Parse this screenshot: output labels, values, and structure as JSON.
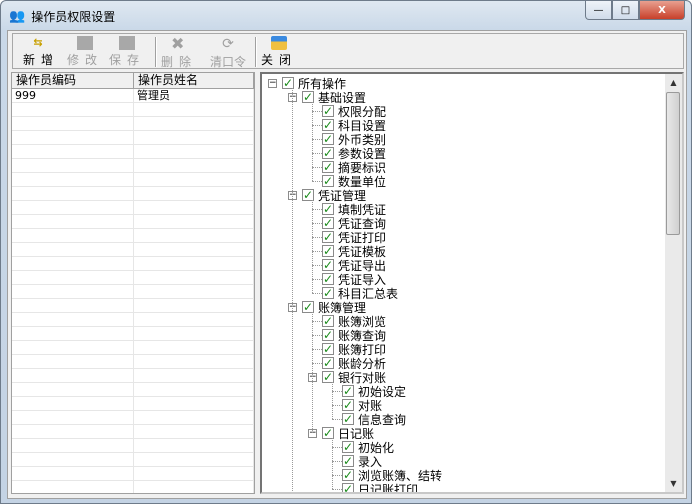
{
  "window": {
    "title": "操作员权限设置",
    "minimize": "—",
    "maximize": "□",
    "close": "X"
  },
  "toolbar": [
    {
      "label": "新增",
      "icon": "new-icon",
      "enabled": true
    },
    {
      "label": "修改",
      "icon": "edit-icon",
      "enabled": false
    },
    {
      "label": "保存",
      "icon": "save-icon",
      "enabled": false
    },
    {
      "label": "删除",
      "icon": "delete-icon",
      "enabled": false
    },
    {
      "label": "清口令",
      "icon": "clear-password-icon",
      "enabled": false
    },
    {
      "label": "关闭",
      "icon": "close-folder-icon",
      "enabled": true
    }
  ],
  "grid": {
    "headers": [
      "操作员编码",
      "操作员姓名"
    ],
    "rows": [
      [
        "999",
        "管理员"
      ]
    ]
  },
  "tree": [
    {
      "label": "所有操作",
      "level": 0,
      "expanded": true,
      "checked": true
    },
    {
      "label": "基础设置",
      "level": 1,
      "expanded": true,
      "checked": true
    },
    {
      "label": "权限分配",
      "level": 2,
      "checked": true
    },
    {
      "label": "科目设置",
      "level": 2,
      "checked": true
    },
    {
      "label": "外币类别",
      "level": 2,
      "checked": true
    },
    {
      "label": "参数设置",
      "level": 2,
      "checked": true
    },
    {
      "label": "摘要标识",
      "level": 2,
      "checked": true
    },
    {
      "label": "数量单位",
      "level": 2,
      "checked": true
    },
    {
      "label": "凭证管理",
      "level": 1,
      "expanded": true,
      "checked": true
    },
    {
      "label": "填制凭证",
      "level": 2,
      "checked": true
    },
    {
      "label": "凭证查询",
      "level": 2,
      "checked": true
    },
    {
      "label": "凭证打印",
      "level": 2,
      "checked": true
    },
    {
      "label": "凭证模板",
      "level": 2,
      "checked": true
    },
    {
      "label": "凭证导出",
      "level": 2,
      "checked": true
    },
    {
      "label": "凭证导入",
      "level": 2,
      "checked": true
    },
    {
      "label": "科目汇总表",
      "level": 2,
      "checked": true
    },
    {
      "label": "账簿管理",
      "level": 1,
      "expanded": true,
      "checked": true
    },
    {
      "label": "账簿浏览",
      "level": 2,
      "checked": true
    },
    {
      "label": "账簿查询",
      "level": 2,
      "checked": true
    },
    {
      "label": "账簿打印",
      "level": 2,
      "checked": true
    },
    {
      "label": "账龄分析",
      "level": 2,
      "checked": true
    },
    {
      "label": "银行对账",
      "level": 2,
      "expanded": true,
      "checked": true
    },
    {
      "label": "初始设定",
      "level": 3,
      "checked": true
    },
    {
      "label": "对账",
      "level": 3,
      "checked": true
    },
    {
      "label": "信息查询",
      "level": 3,
      "checked": true
    },
    {
      "label": "日记账",
      "level": 2,
      "expanded": true,
      "checked": true
    },
    {
      "label": "初始化",
      "level": 3,
      "checked": true
    },
    {
      "label": "录入",
      "level": 3,
      "checked": true
    },
    {
      "label": "浏览账簿、结转",
      "level": 3,
      "checked": true
    },
    {
      "label": "日记账打印",
      "level": 3,
      "checked": true
    }
  ],
  "scroll": {
    "position_fraction": 0.0,
    "visible_fraction": 0.35
  }
}
